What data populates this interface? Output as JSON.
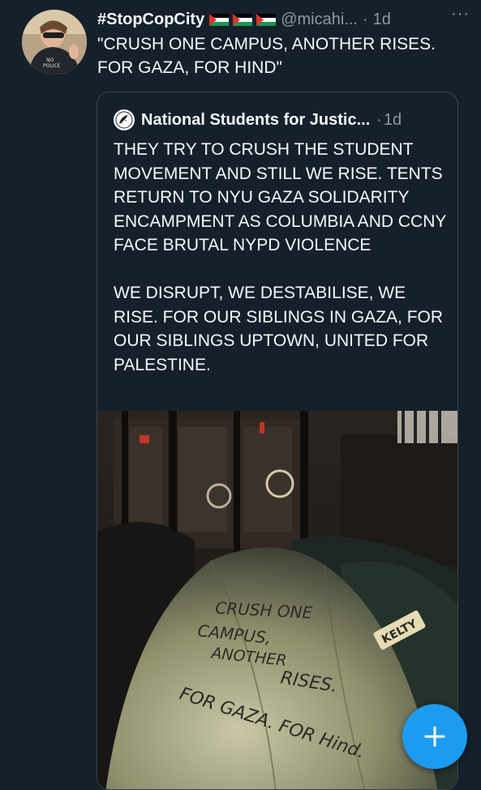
{
  "tweet": {
    "display_name": "#StopCopCity",
    "flags": [
      "palestine-flag",
      "palestine-flag",
      "palestine-flag"
    ],
    "handle": "@micahi...",
    "separator": "·",
    "time": "1d",
    "more": "···",
    "text": "\"CRUSH ONE CAMPUS, ANOTHER RISES.\nFOR GAZA, FOR HIND\""
  },
  "quote": {
    "name": "National Students for Justic...",
    "separator": "·",
    "time": "1d",
    "text": "THEY TRY TO CRUSH THE STUDENT MOVEMENT AND STILL WE RISE. TENTS RETURN TO NYU GAZA SOLIDARITY ENCAMPMENT AS COLUMBIA AND CCNY FACE BRUTAL NYPD VIOLENCE\n\nWE DISRUPT, WE DESTABILISE, WE RISE. FOR OUR SIBLINGS IN GAZA, FOR OUR SIBLINGS UPTOWN, UNITED FOR PALESTINE.",
    "media": {
      "tent_handwriting": [
        "CRUSH ONE",
        "CAMPUS,",
        "ANOTHER",
        "RISES.",
        "FOR GAZA. FOR Hind."
      ],
      "tent_brand": "KELTY"
    }
  },
  "fab": {
    "icon": "plus-icon"
  },
  "colors": {
    "background": "#15202b",
    "text": "#f7f9f9",
    "secondary": "#8b98a5",
    "border": "#38444d",
    "accent": "#1d9bf0"
  }
}
